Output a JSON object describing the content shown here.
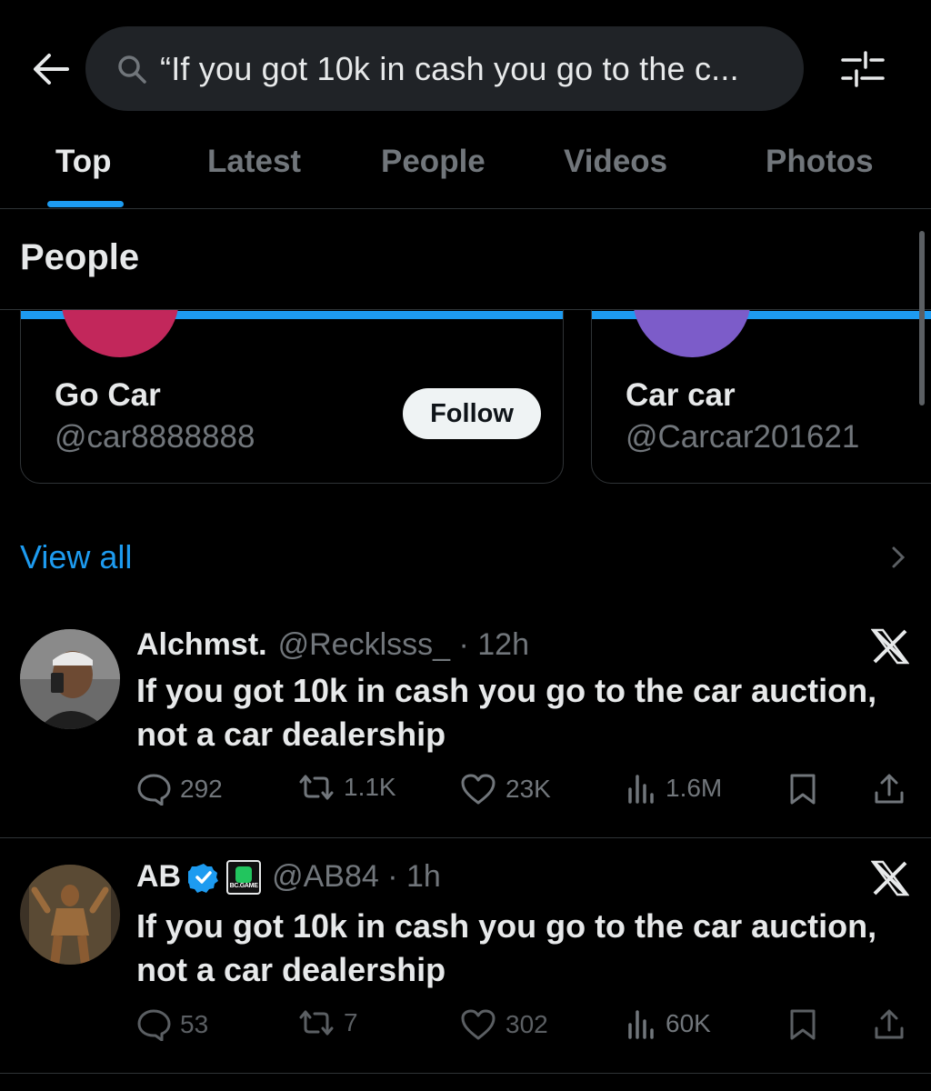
{
  "search": {
    "query": "“If you got 10k in cash you go to the c..."
  },
  "tabs": [
    {
      "label": "Top"
    },
    {
      "label": "Latest"
    },
    {
      "label": "People"
    },
    {
      "label": "Videos"
    },
    {
      "label": "Photos"
    }
  ],
  "people_section": {
    "title": "People",
    "cards": [
      {
        "name": "Go Car",
        "handle": "@car8888888",
        "follow_label": "Follow",
        "avatar_color": "#c2275b"
      },
      {
        "name": "Car car",
        "handle": "@Carcar201621",
        "avatar_color": "#7c5cc9"
      }
    ],
    "view_all": "View all"
  },
  "posts": [
    {
      "name": "Alchmst.",
      "handle": "@Recklsss_ · 12h",
      "text": "If you got 10k in cash you go to the car auction, not a car dealership",
      "replies": "292",
      "reposts": "1.1K",
      "likes": "23K",
      "views": "1.6M"
    },
    {
      "name": "AB",
      "handle": "@AB84 · 1h",
      "badge": "BC.GAME",
      "text": "If you got 10k in cash you go to the car auction, not a car dealership",
      "replies": "53",
      "reposts": "7",
      "likes": "302",
      "views": "60K"
    }
  ],
  "colors": {
    "accent": "#1d9bf0",
    "background": "#000000",
    "muted_text": "#71767b"
  }
}
